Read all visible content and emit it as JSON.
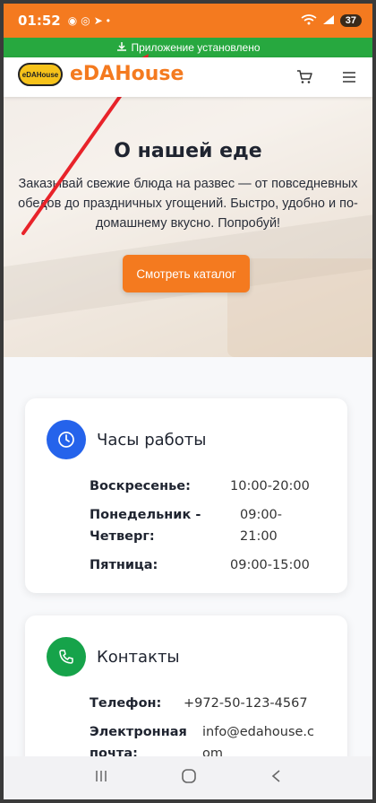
{
  "status_bar": {
    "time": "01:52",
    "battery": "37"
  },
  "install_banner": {
    "text": "Приложение установлено"
  },
  "header": {
    "logo_text": "eDAHouse",
    "brand": "eDAHouse"
  },
  "hero": {
    "title": "О нашей еде",
    "text": "Заказывай свежие блюда на развес — от повседневных обедов до праздничных угощений. Быстро, удобно и по-домашнему вкусно. Попробуй!",
    "button": "Смотреть каталог"
  },
  "hours": {
    "title": "Часы работы",
    "rows": [
      {
        "label": "Воскресенье:",
        "value": "10:00-20:00"
      },
      {
        "label": "Понедельник - Четверг:",
        "value": "09:00-21:00"
      },
      {
        "label": "Пятница:",
        "value": "09:00-15:00"
      }
    ]
  },
  "contacts": {
    "title": "Контакты",
    "rows": [
      {
        "label": "Телефон:",
        "value": "+972-50-123-4567"
      },
      {
        "label": "Электронная почта:",
        "value": "info@edahouse.com"
      }
    ]
  },
  "colors": {
    "brand_orange": "#f47a1f",
    "banner_green": "#27a83f",
    "hours_icon_bg": "#2563eb",
    "contacts_icon_bg": "#16a34a",
    "annotation_red": "#e8232a"
  },
  "icons": {
    "cart": "cart-icon",
    "menu": "menu-icon",
    "clock": "clock-icon",
    "phone": "phone-icon",
    "download": "download-icon"
  }
}
